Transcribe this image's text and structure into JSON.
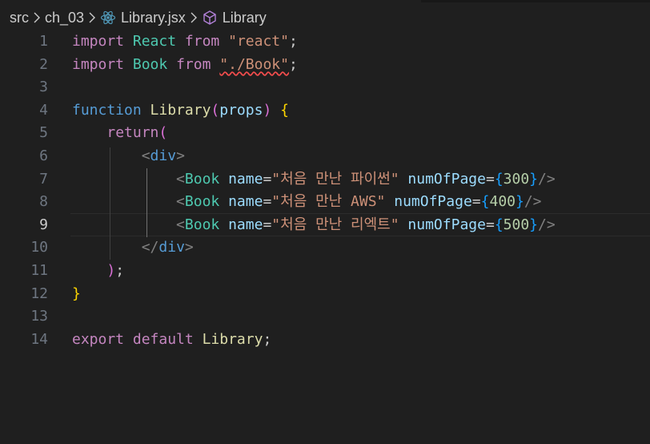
{
  "breadcrumb": {
    "items": [
      "src",
      "ch_03",
      "Library.jsx",
      "Library"
    ],
    "icons": [
      "react-icon",
      "symbol-class-icon"
    ]
  },
  "editor": {
    "active_line": 9,
    "line_numbers": [
      "1",
      "2",
      "3",
      "4",
      "5",
      "6",
      "7",
      "8",
      "9",
      "10",
      "11",
      "12",
      "13",
      "14"
    ],
    "code": {
      "l1": {
        "t1": "import",
        "t2": " ",
        "t3": "React",
        "t4": " ",
        "t5": "from",
        "t6": " ",
        "t7": "\"react\"",
        "t8": ";"
      },
      "l2": {
        "t1": "import",
        "t2": " ",
        "t3": "Book",
        "t4": " ",
        "t5": "from",
        "t6": " ",
        "t7": "\"./Book\"",
        "t8": ";"
      },
      "l4": {
        "t1": "function",
        "t2": " ",
        "t3": "Library",
        "t4": "(",
        "t5": "props",
        "t6": ")",
        "t7": " ",
        "t8": "{"
      },
      "l5": {
        "t1": "    ",
        "t2": "return",
        "t3": "("
      },
      "l6": {
        "t1": "        ",
        "t2": "<",
        "t3": "div",
        "t4": ">"
      },
      "l7": {
        "t1": "            ",
        "t2": "<",
        "t3": "Book",
        "t4": " ",
        "t5": "name",
        "t6": "=",
        "t7": "\"처음 만난 파이썬\"",
        "t8": " ",
        "t9": "numOfPage",
        "t10": "=",
        "t11": "{",
        "t12": "300",
        "t13": "}",
        "t14": "/>"
      },
      "l8": {
        "t1": "            ",
        "t2": "<",
        "t3": "Book",
        "t4": " ",
        "t5": "name",
        "t6": "=",
        "t7": "\"처음 만난 AWS\"",
        "t8": " ",
        "t9": "numOfPage",
        "t10": "=",
        "t11": "{",
        "t12": "400",
        "t13": "}",
        "t14": "/>"
      },
      "l9": {
        "t1": "            ",
        "t2": "<",
        "t3": "Book",
        "t4": " ",
        "t5": "name",
        "t6": "=",
        "t7": "\"처음 만난 리엑트\"",
        "t8": " ",
        "t9": "numOfPage",
        "t10": "=",
        "t11": "{",
        "t12": "500",
        "t13": "}",
        "t14": "/>"
      },
      "l10": {
        "t1": "        ",
        "t2": "</",
        "t3": "div",
        "t4": ">"
      },
      "l11": {
        "t1": "    ",
        "t2": ")",
        "t3": ";"
      },
      "l12": {
        "t1": "}"
      },
      "l14": {
        "t1": "export",
        "t2": " ",
        "t3": "default",
        "t4": " ",
        "t5": "Library",
        "t6": ";"
      }
    }
  },
  "colors": {
    "background": "#1f1f1f",
    "keyword_control": "#c586c0",
    "keyword_storage": "#569cd6",
    "type": "#4ec9b0",
    "function": "#dcdcaa",
    "string": "#ce9178",
    "number": "#b5cea8",
    "variable": "#9cdcfe",
    "bracket_gold": "#ffd700",
    "bracket_orchid": "#da70d6",
    "bracket_blue": "#179fff",
    "error_squiggle": "#f14c4c"
  }
}
